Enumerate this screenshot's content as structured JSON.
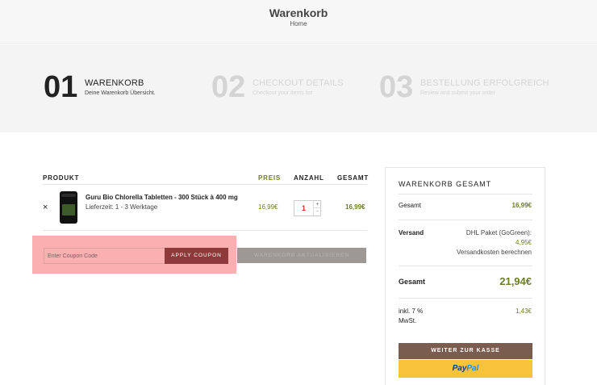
{
  "header": {
    "title": "Warenkorb",
    "breadcrumb": "Home"
  },
  "steps": [
    {
      "number": "01",
      "title": "WARENKORB",
      "subtitle": "Deine Warenkorb Übersicht.",
      "active": true
    },
    {
      "number": "02",
      "title": "CHECKOUT DETAILS",
      "subtitle": "Checkout your items list",
      "active": false
    },
    {
      "number": "03",
      "title": "BESTELLUNG ERFOLGREICH",
      "subtitle": "Review and submit your order",
      "active": false
    }
  ],
  "cart_table": {
    "headers": {
      "product": "PRODUKT",
      "price": "PREIS",
      "quantity": "ANZAHL",
      "total": "GESAMT"
    },
    "rows": [
      {
        "remove": "×",
        "name": "Guru Bio Chlorella Tabletten - 300 Stück à 400 mg",
        "delivery": "Lieferzeit: 1 - 3 Werktage",
        "price": "16,99€",
        "quantity": "1",
        "subtotal": "16,99€"
      }
    ]
  },
  "coupon": {
    "placeholder": "Enter Coupon Code",
    "apply_label": "APPLY COUPON"
  },
  "update_cart_label": "WARENKORB AKTUALISIEREN",
  "totals": {
    "title": "WARENKORB GESAMT",
    "subtotal_label": "Gesamt",
    "subtotal_value": "16,99€",
    "shipping_label": "Versand",
    "shipping_method": "DHL Paket (GoGreen):",
    "shipping_value": "4,95€",
    "shipping_note": "Versandkosten berechnen",
    "total_label": "Gesamt",
    "total_value": "21,94€",
    "tax_label_line1": "inkl. 7 %",
    "tax_label_line2": "MwSt.",
    "tax_value": "1,43€",
    "checkout_label": "WEITER ZUR KASSE",
    "paypal_part1": "Pay",
    "paypal_part2": "Pal"
  },
  "colors": {
    "accent_green": "#6b7c2b",
    "checkout_brown": "#7a5d4e",
    "coupon_red": "#8f3a3a",
    "paypal_yellow": "#f7c33b"
  }
}
